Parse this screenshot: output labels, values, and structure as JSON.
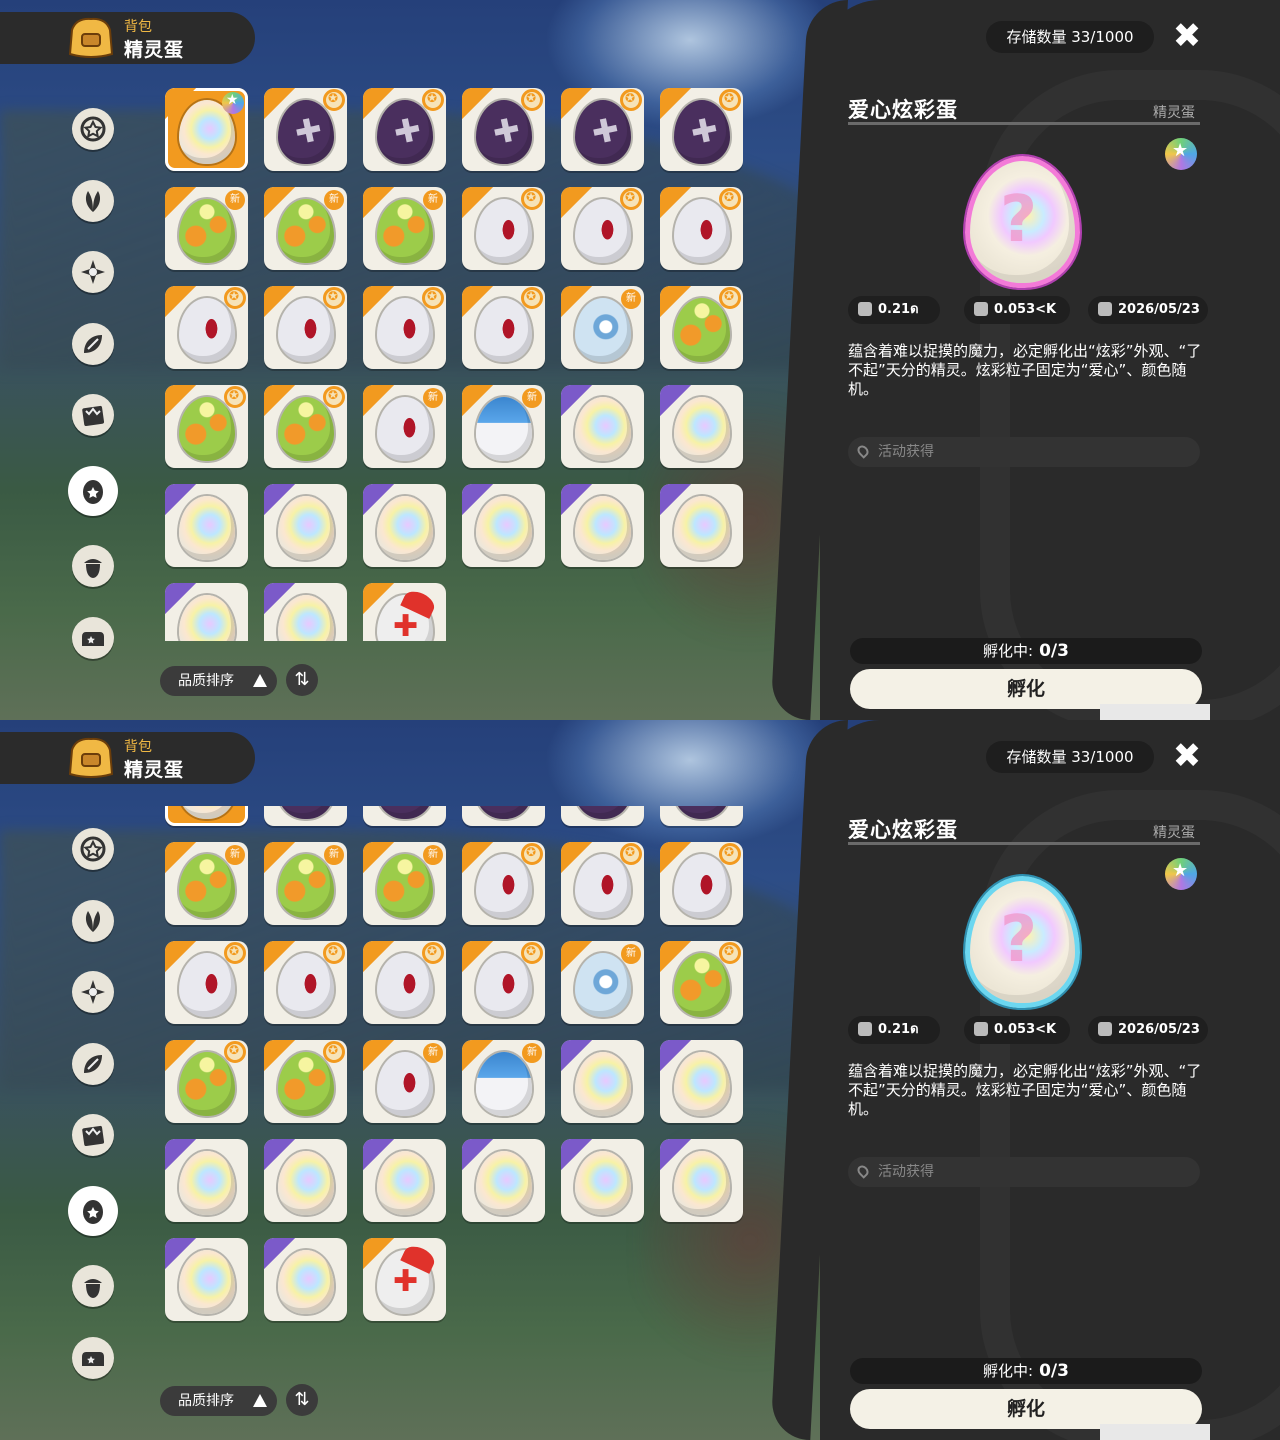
{
  "panels": [
    {
      "header": {
        "sub": "背包",
        "title": "精灵蛋"
      },
      "storage": "存储数量 33/1000",
      "sort": {
        "label": "品质排序"
      },
      "categories": [
        "star-badge",
        "leaf",
        "sparkle",
        "petal",
        "card",
        "egg",
        "acorn",
        "sofa"
      ],
      "active_category": 5,
      "item": {
        "name": "爱心炫彩蛋",
        "type": "精灵蛋",
        "egg_border": "pink",
        "stats": {
          "size": "0.21ด",
          "weight": "0.053<K",
          "date": "2026/05/23"
        },
        "description": "蕴含着难以捉摸的魔力，必定孵化出“炫彩”外观、“了不起”天分的精灵。炫彩粒子固定为“爱心”、颜色随机。",
        "source": "活动获得"
      },
      "incubating": {
        "label": "孵化中:",
        "value": "0/3"
      },
      "hatch_label": "孵化",
      "scroll_offset": 0
    },
    {
      "header": {
        "sub": "背包",
        "title": "精灵蛋"
      },
      "storage": "存储数量 33/1000",
      "sort": {
        "label": "品质排序"
      },
      "categories": [
        "star-badge",
        "leaf",
        "sparkle",
        "petal",
        "card",
        "egg",
        "acorn",
        "sofa"
      ],
      "active_category": 5,
      "item": {
        "name": "爱心炫彩蛋",
        "type": "精灵蛋",
        "egg_border": "cyan",
        "stats": {
          "size": "0.21ด",
          "weight": "0.053<K",
          "date": "2026/05/23"
        },
        "description": "蕴含着难以捉摸的魔力，必定孵化出“炫彩”外观、“了不起”天分的精灵。炫彩粒子固定为“爱心”、颜色随机。",
        "source": "活动获得"
      },
      "incubating": {
        "label": "孵化中:",
        "value": "0/3"
      },
      "hatch_label": "孵化",
      "scroll_offset": 1
    }
  ],
  "eggs": [
    {
      "kind": "rainbow",
      "corner": "orange",
      "badge": "star",
      "selected": true
    },
    {
      "kind": "dark",
      "corner": "orange",
      "badge": "medal"
    },
    {
      "kind": "dark",
      "corner": "orange",
      "badge": "medal"
    },
    {
      "kind": "dark",
      "corner": "orange",
      "badge": "medal"
    },
    {
      "kind": "dark",
      "corner": "orange",
      "badge": "medal"
    },
    {
      "kind": "dark",
      "corner": "orange",
      "badge": "medal"
    },
    {
      "kind": "green",
      "corner": "orange",
      "badge": "new"
    },
    {
      "kind": "green",
      "corner": "orange",
      "badge": "new"
    },
    {
      "kind": "green",
      "corner": "orange",
      "badge": "new"
    },
    {
      "kind": "white",
      "corner": "orange",
      "badge": "medal"
    },
    {
      "kind": "white",
      "corner": "orange",
      "badge": "medal"
    },
    {
      "kind": "white",
      "corner": "orange",
      "badge": "medal"
    },
    {
      "kind": "white",
      "corner": "orange",
      "badge": "medal"
    },
    {
      "kind": "white",
      "corner": "orange",
      "badge": "medal"
    },
    {
      "kind": "white",
      "corner": "orange",
      "badge": "medal"
    },
    {
      "kind": "white",
      "corner": "orange",
      "badge": "medal"
    },
    {
      "kind": "lightblue",
      "corner": "orange",
      "badge": "new"
    },
    {
      "kind": "green",
      "corner": "orange",
      "badge": "medal"
    },
    {
      "kind": "green",
      "corner": "orange",
      "badge": "medal"
    },
    {
      "kind": "green",
      "corner": "orange",
      "badge": "medal"
    },
    {
      "kind": "white",
      "corner": "orange",
      "badge": "new"
    },
    {
      "kind": "bluewhite",
      "corner": "orange",
      "badge": "new"
    },
    {
      "kind": "rainbow",
      "corner": "purple",
      "badge": ""
    },
    {
      "kind": "rainbow",
      "corner": "purple",
      "badge": ""
    },
    {
      "kind": "rainbow",
      "corner": "purple",
      "badge": ""
    },
    {
      "kind": "rainbow",
      "corner": "purple",
      "badge": ""
    },
    {
      "kind": "rainbow",
      "corner": "purple",
      "badge": ""
    },
    {
      "kind": "rainbow",
      "corner": "purple",
      "badge": ""
    },
    {
      "kind": "rainbow",
      "corner": "purple",
      "badge": ""
    },
    {
      "kind": "rainbow",
      "corner": "purple",
      "badge": ""
    },
    {
      "kind": "rainbow",
      "corner": "purple",
      "badge": ""
    },
    {
      "kind": "rainbow",
      "corner": "purple",
      "badge": ""
    },
    {
      "kind": "redcross",
      "corner": "orange",
      "badge": ""
    }
  ],
  "new_badge_text": "新",
  "order_icon": "⇅",
  "close_icon": "✖",
  "colors": {
    "accent": "#f29a1f",
    "purple": "#7b5ac9",
    "panel": "#2a2a2a"
  }
}
